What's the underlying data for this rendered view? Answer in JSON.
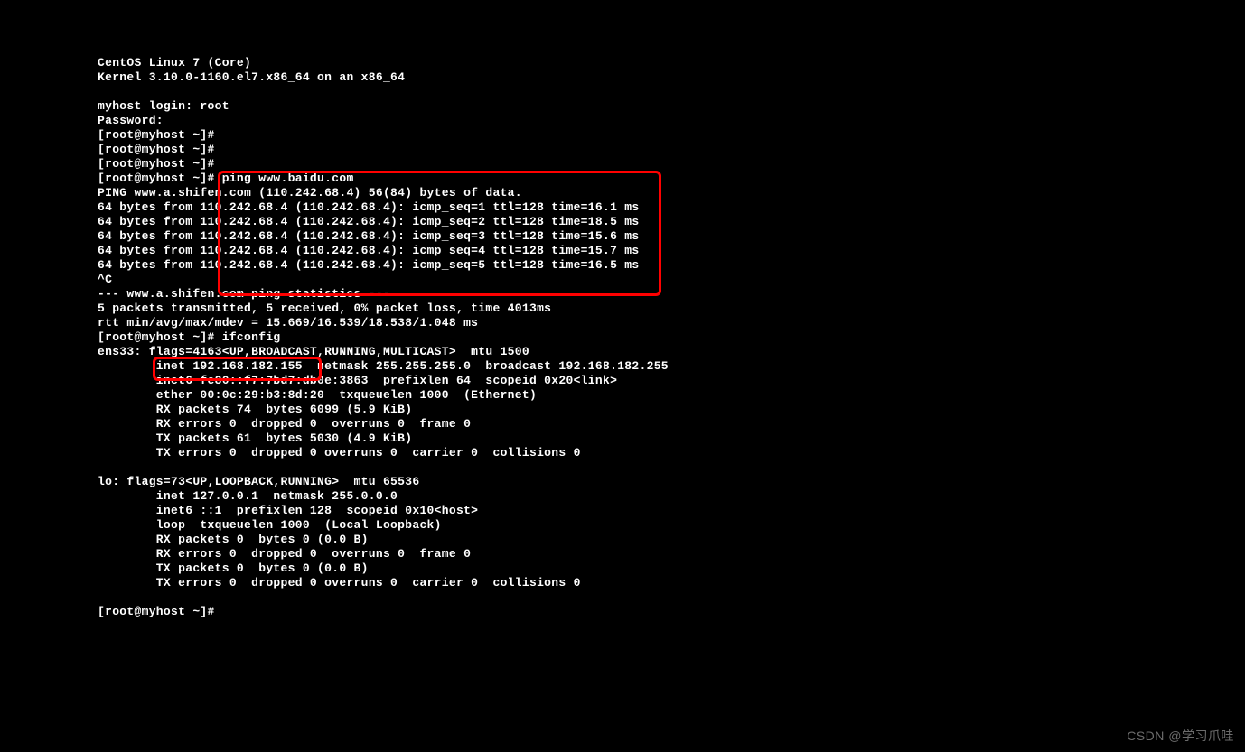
{
  "terminal": {
    "lines": [
      "CentOS Linux 7 (Core)",
      "Kernel 3.10.0-1160.el7.x86_64 on an x86_64",
      "",
      "myhost login: root",
      "Password:",
      "[root@myhost ~]#",
      "[root@myhost ~]#",
      "[root@myhost ~]#",
      "[root@myhost ~]# ping www.baidu.com",
      "PING www.a.shifen.com (110.242.68.4) 56(84) bytes of data.",
      "64 bytes from 110.242.68.4 (110.242.68.4): icmp_seq=1 ttl=128 time=16.1 ms",
      "64 bytes from 110.242.68.4 (110.242.68.4): icmp_seq=2 ttl=128 time=18.5 ms",
      "64 bytes from 110.242.68.4 (110.242.68.4): icmp_seq=3 ttl=128 time=15.6 ms",
      "64 bytes from 110.242.68.4 (110.242.68.4): icmp_seq=4 ttl=128 time=15.7 ms",
      "64 bytes from 110.242.68.4 (110.242.68.4): icmp_seq=5 ttl=128 time=16.5 ms",
      "^C",
      "--- www.a.shifen.com ping statistics ---",
      "5 packets transmitted, 5 received, 0% packet loss, time 4013ms",
      "rtt min/avg/max/mdev = 15.669/16.539/18.538/1.048 ms",
      "[root@myhost ~]# ifconfig",
      "ens33: flags=4163<UP,BROADCAST,RUNNING,MULTICAST>  mtu 1500",
      "        inet 192.168.182.155  netmask 255.255.255.0  broadcast 192.168.182.255",
      "        inet6 fe80::f7:7bd7:db0e:3863  prefixlen 64  scopeid 0x20<link>",
      "        ether 00:0c:29:b3:8d:20  txqueuelen 1000  (Ethernet)",
      "        RX packets 74  bytes 6099 (5.9 KiB)",
      "        RX errors 0  dropped 0  overruns 0  frame 0",
      "        TX packets 61  bytes 5030 (4.9 KiB)",
      "        TX errors 0  dropped 0 overruns 0  carrier 0  collisions 0",
      "",
      "lo: flags=73<UP,LOOPBACK,RUNNING>  mtu 65536",
      "        inet 127.0.0.1  netmask 255.0.0.0",
      "        inet6 ::1  prefixlen 128  scopeid 0x10<host>",
      "        loop  txqueuelen 1000  (Local Loopback)",
      "        RX packets 0  bytes 0 (0.0 B)",
      "        RX errors 0  dropped 0  overruns 0  frame 0",
      "        TX packets 0  bytes 0 (0.0 B)",
      "        TX errors 0  dropped 0 overruns 0  carrier 0  collisions 0",
      "",
      "[root@myhost ~]#"
    ]
  },
  "watermark": {
    "text": "CSDN @学习爪哇"
  },
  "annotations": {
    "box1_desc": "ping-command-output-highlight",
    "box2_desc": "inet-ip-address-highlight"
  }
}
